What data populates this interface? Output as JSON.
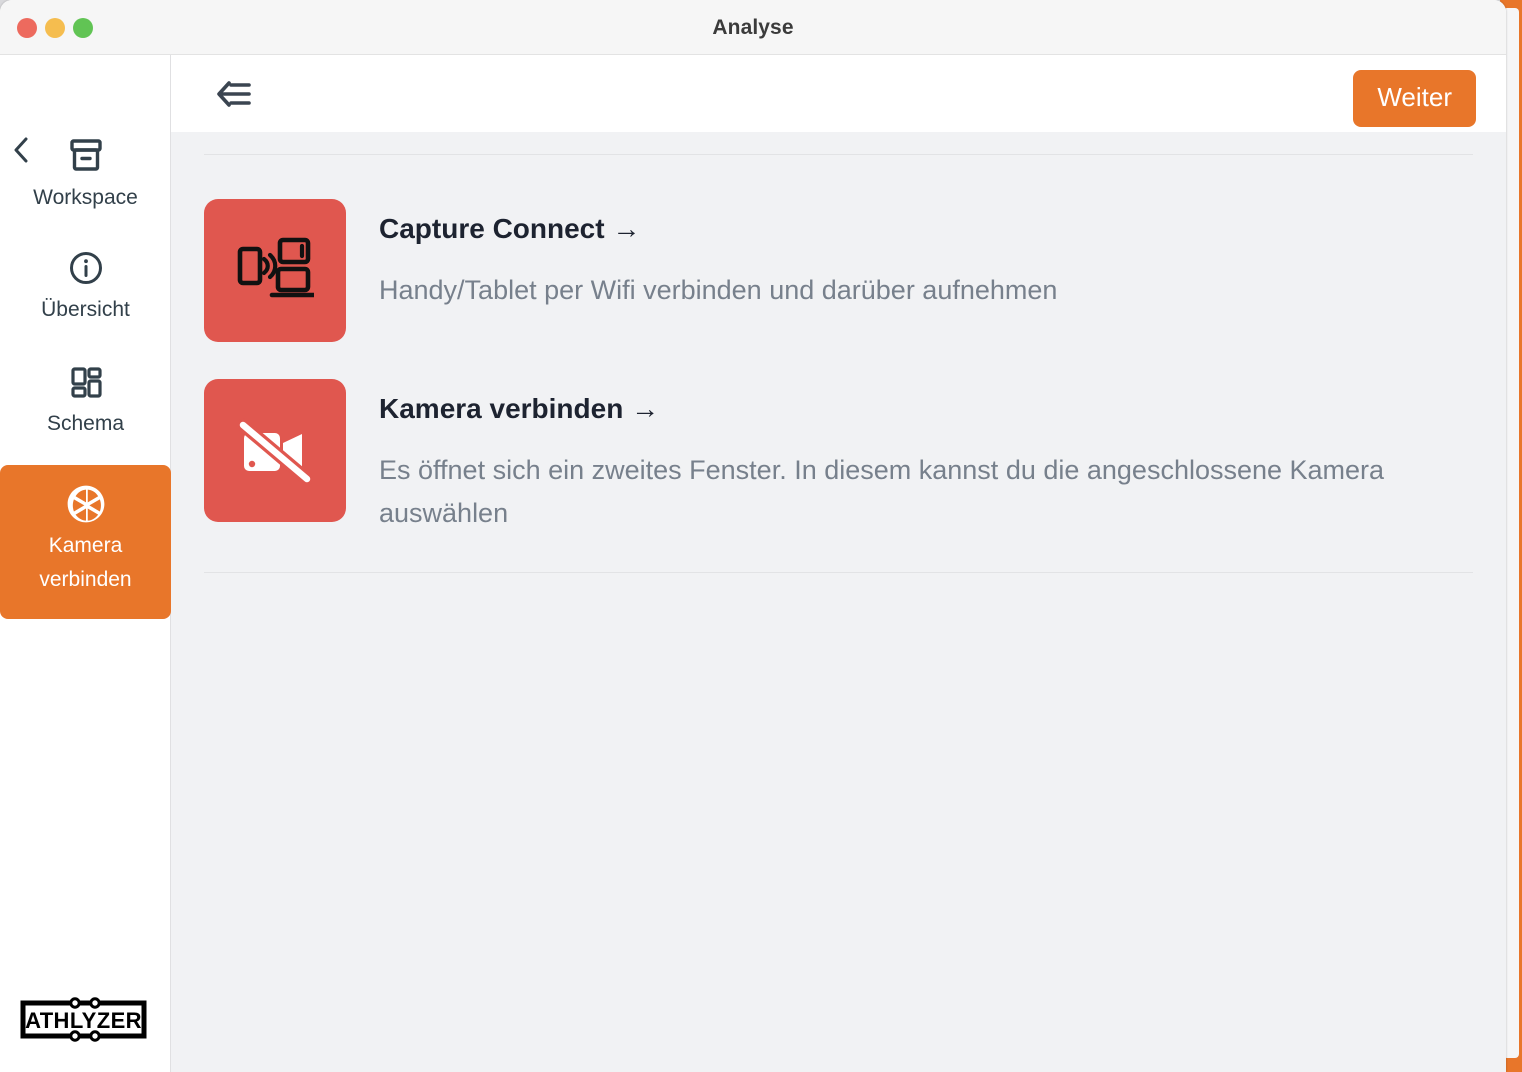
{
  "window": {
    "title": "Analyse",
    "traffic_lights": [
      {
        "name": "close",
        "color": "#ED6A5E"
      },
      {
        "name": "minimize",
        "color": "#F5BD4F"
      },
      {
        "name": "zoom",
        "color": "#61C454"
      }
    ]
  },
  "sidebar": {
    "back_icon": "chevron-left-icon",
    "items": [
      {
        "label": "Workspace",
        "icon": "archive-box-icon",
        "active": false
      },
      {
        "label": "Übersicht",
        "icon": "info-circle-icon",
        "active": false
      },
      {
        "label": "Schema",
        "icon": "grid-layout-icon",
        "active": false
      },
      {
        "label": "Kamera\nverbinden",
        "label_line1": "Kamera",
        "label_line2": "verbinden",
        "icon": "camera-aperture-icon",
        "active": true
      }
    ],
    "logo": {
      "text": "ATHLYZER",
      "name": "athlyzer-logo"
    }
  },
  "toolbar": {
    "collapse_icon": "arrow-left-lines-icon",
    "next_button_label": "Weiter"
  },
  "content": {
    "options": [
      {
        "title": "Capture Connect",
        "arrow": "→",
        "description": "Handy/Tablet per Wifi verbinden und darüber aufnehmen",
        "icon": "devices-wireless-cast-icon"
      },
      {
        "title": "Kamera verbinden",
        "arrow": "→",
        "description": "Es öffnet sich ein zweites Fenster. In diesem kannst du die angeschlossene Kamera auswählen",
        "icon": "camera-off-icon"
      }
    ]
  },
  "colors": {
    "accent_orange": "#E8762A",
    "tile_red": "#E0574F",
    "content_bg": "#F1F2F4",
    "text_dark": "#1D2330",
    "text_muted": "#77808C",
    "sidebar_text": "#32404A"
  }
}
